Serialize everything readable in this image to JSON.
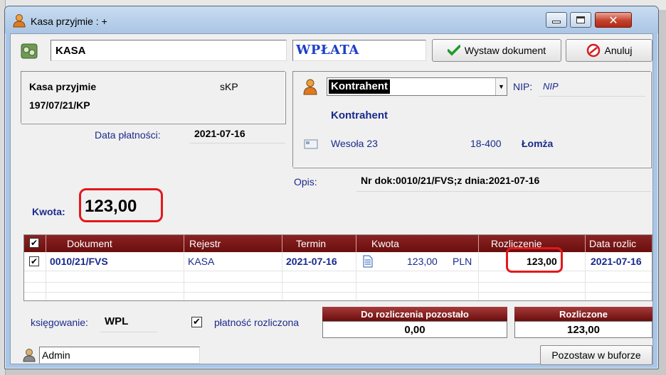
{
  "window": {
    "title": "Kasa przyjmie : +"
  },
  "toolbar": {
    "register_name": "KASA",
    "operation_type": "WPŁATA",
    "issue_button": "Wystaw dokument",
    "cancel_button": "Anuluj"
  },
  "document": {
    "type_name": "Kasa przyjmie",
    "type_code": "sKP",
    "number": "197/07/21/KP",
    "payment_date_label": "Data płatności:",
    "payment_date": "2021-07-16"
  },
  "contractor": {
    "selected": "Kontrahent",
    "nip_label": "NIP:",
    "nip_value": "NIP",
    "name": "Kontrahent",
    "street": "Wesoła 23",
    "postal_code": "18-400",
    "city": "Łomża"
  },
  "description": {
    "label": "Opis:",
    "value": "Nr dok:0010/21/FVS;z dnia:2021-07-16"
  },
  "amount": {
    "label": "Kwota:",
    "value": "123,00"
  },
  "grid": {
    "columns": [
      "Dokument",
      "Rejestr",
      "Termin",
      "Kwota",
      "Rozliczenie",
      "Data rozlic"
    ],
    "rows": [
      {
        "checked": true,
        "document": "0010/21/FVS",
        "register": "KASA",
        "due_date": "2021-07-16",
        "amount": "123,00",
        "currency": "PLN",
        "settlement": "123,00",
        "settlement_date": "2021-07-16"
      }
    ]
  },
  "footer": {
    "posting_label": "księgowanie:",
    "posting_value": "WPL",
    "payment_settled_label": "płatność rozliczona",
    "payment_settled_checked": true,
    "remaining_label": "Do rozliczenia pozostało",
    "remaining_value": "0,00",
    "settled_label": "Rozliczone",
    "settled_value": "123,00",
    "user": "Admin",
    "buffer_button": "Pozostaw w buforze"
  },
  "colors": {
    "grid_header": "#7a1717",
    "highlight": "#e3181c",
    "label_navy": "#1a2a8c",
    "wplata_blue": "#1d3fc7"
  },
  "icons": {
    "title": "user-orange-icon",
    "register": "cash-register-icon",
    "issue": "checkmark-icon",
    "cancel": "cancel-circle-icon",
    "contractor": "user-orange-icon",
    "address": "envelope-icon",
    "document_row": "document-icon",
    "footer_user": "user-grey-icon"
  }
}
